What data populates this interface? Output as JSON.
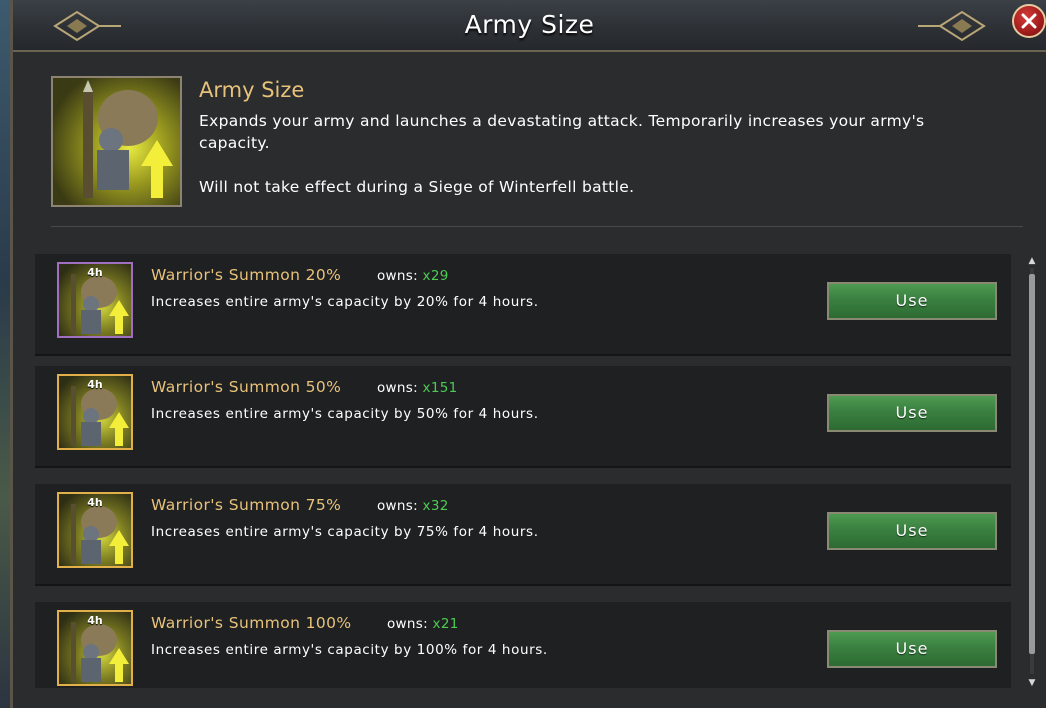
{
  "window": {
    "title": "Army Size"
  },
  "header": {
    "title": "Army Size",
    "description": "Expands your army and launches a devastating attack. Temporarily increases your army's capacity.",
    "note": "Will not take effect during a Siege of Winterfell battle."
  },
  "items": [
    {
      "name": "Warrior's Summon 20%",
      "owns_label": "owns:",
      "owns_count": "x29",
      "badge": "4h",
      "description": "Increases entire army's capacity by 20% for 4 hours.",
      "button": "Use",
      "frame": "purple"
    },
    {
      "name": "Warrior's Summon 50%",
      "owns_label": "owns:",
      "owns_count": "x151",
      "badge": "4h",
      "description": "Increases entire army's capacity by 50% for 4 hours.",
      "button": "Use",
      "frame": "gold"
    },
    {
      "name": "Warrior's Summon 75%",
      "owns_label": "owns:",
      "owns_count": "x32",
      "badge": "4h",
      "description": "Increases entire army's capacity by 75% for 4 hours.",
      "button": "Use",
      "frame": "gold"
    },
    {
      "name": "Warrior's Summon 100%",
      "owns_label": "owns:",
      "owns_count": "x21",
      "badge": "4h",
      "description": "Increases entire army's capacity by 100% for 4 hours.",
      "button": "Use",
      "frame": "gold"
    }
  ],
  "colors": {
    "accent_gold": "#e8c27a",
    "owns_green": "#4ccc52",
    "button_green": "#3a8040",
    "close_red": "#a01c1c"
  },
  "icons": {
    "close": "close-x-icon",
    "item": "warrior-summon-icon"
  }
}
